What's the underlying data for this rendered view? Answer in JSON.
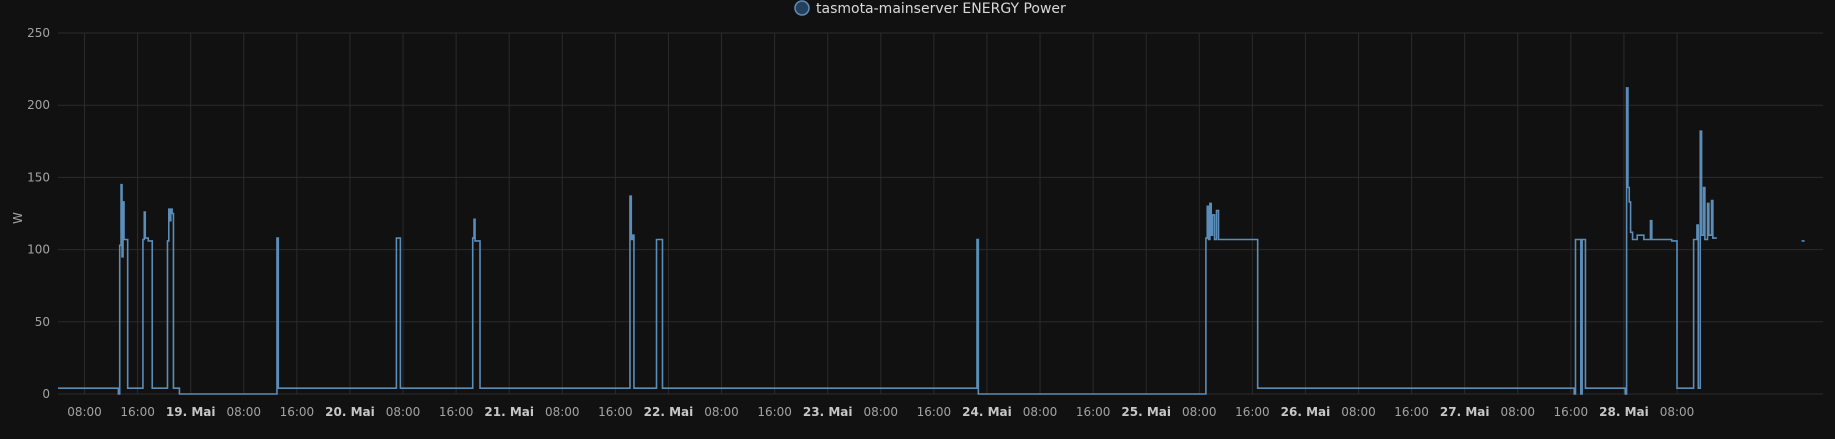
{
  "colors": {
    "background": "#111111",
    "grid": "#2b2b2b",
    "series": "#5b8db8",
    "legend_dot_fill": "#23405c",
    "legend_dot_stroke": "#5b8db8"
  },
  "chart_data": {
    "type": "line",
    "ylabel": "W",
    "ylim": [
      0,
      250
    ],
    "yticks": [
      0,
      50,
      100,
      150,
      200,
      250
    ],
    "xlim_hours": [
      0,
      266
    ],
    "x_ticks": [
      {
        "t": 4,
        "label": "08:00",
        "bold": false
      },
      {
        "t": 12,
        "label": "16:00",
        "bold": false
      },
      {
        "t": 20,
        "label": "19. Mai",
        "bold": true
      },
      {
        "t": 28,
        "label": "08:00",
        "bold": false
      },
      {
        "t": 36,
        "label": "16:00",
        "bold": false
      },
      {
        "t": 44,
        "label": "20. Mai",
        "bold": true
      },
      {
        "t": 52,
        "label": "08:00",
        "bold": false
      },
      {
        "t": 60,
        "label": "16:00",
        "bold": false
      },
      {
        "t": 68,
        "label": "21. Mai",
        "bold": true
      },
      {
        "t": 76,
        "label": "08:00",
        "bold": false
      },
      {
        "t": 84,
        "label": "16:00",
        "bold": false
      },
      {
        "t": 92,
        "label": "22. Mai",
        "bold": true
      },
      {
        "t": 100,
        "label": "08:00",
        "bold": false
      },
      {
        "t": 108,
        "label": "16:00",
        "bold": false
      },
      {
        "t": 116,
        "label": "23. Mai",
        "bold": true
      },
      {
        "t": 124,
        "label": "08:00",
        "bold": false
      },
      {
        "t": 132,
        "label": "16:00",
        "bold": false
      },
      {
        "t": 140,
        "label": "24. Mai",
        "bold": true
      },
      {
        "t": 148,
        "label": "08:00",
        "bold": false
      },
      {
        "t": 156,
        "label": "16:00",
        "bold": false
      },
      {
        "t": 164,
        "label": "25. Mai",
        "bold": true
      },
      {
        "t": 172,
        "label": "08:00",
        "bold": false
      },
      {
        "t": 180,
        "label": "16:00",
        "bold": false
      },
      {
        "t": 188,
        "label": "26. Mai",
        "bold": true
      },
      {
        "t": 196,
        "label": "08:00",
        "bold": false
      },
      {
        "t": 204,
        "label": "16:00",
        "bold": false
      },
      {
        "t": 212,
        "label": "27. Mai",
        "bold": true
      },
      {
        "t": 220,
        "label": "08:00",
        "bold": false
      },
      {
        "t": 228,
        "label": "16:00",
        "bold": false
      },
      {
        "t": 236,
        "label": "28. Mai",
        "bold": true
      },
      {
        "t": 244,
        "label": "08:00",
        "bold": false
      }
    ],
    "grid": true,
    "legend_position": "top-center",
    "series": [
      {
        "name": "tasmota-mainserver ENERGY Power",
        "step": true,
        "points": [
          [
            0,
            4
          ],
          [
            9.1,
            4
          ],
          [
            9.1,
            0
          ],
          [
            9.3,
            0
          ],
          [
            9.3,
            103
          ],
          [
            9.5,
            103
          ],
          [
            9.5,
            145
          ],
          [
            9.65,
            145
          ],
          [
            9.65,
            95
          ],
          [
            9.8,
            95
          ],
          [
            9.8,
            133
          ],
          [
            9.95,
            133
          ],
          [
            9.95,
            107
          ],
          [
            10.5,
            107
          ],
          [
            10.5,
            4
          ],
          [
            12.8,
            4
          ],
          [
            12.8,
            107
          ],
          [
            13.0,
            107
          ],
          [
            13.0,
            126
          ],
          [
            13.15,
            126
          ],
          [
            13.15,
            108
          ],
          [
            13.6,
            108
          ],
          [
            13.6,
            106
          ],
          [
            14.2,
            106
          ],
          [
            14.2,
            4
          ],
          [
            16.5,
            4
          ],
          [
            16.5,
            106
          ],
          [
            16.7,
            106
          ],
          [
            16.7,
            128
          ],
          [
            16.85,
            128
          ],
          [
            16.85,
            120
          ],
          [
            17.0,
            120
          ],
          [
            17.0,
            128
          ],
          [
            17.2,
            128
          ],
          [
            17.2,
            125
          ],
          [
            17.4,
            125
          ],
          [
            17.4,
            4
          ],
          [
            18.3,
            4
          ],
          [
            18.3,
            0
          ],
          [
            33,
            0
          ],
          [
            33,
            108
          ],
          [
            33.2,
            108
          ],
          [
            33.2,
            4
          ],
          [
            51,
            4
          ],
          [
            51,
            108
          ],
          [
            51.6,
            108
          ],
          [
            51.6,
            4
          ],
          [
            62.5,
            4
          ],
          [
            62.5,
            108
          ],
          [
            62.7,
            108
          ],
          [
            62.7,
            121
          ],
          [
            62.85,
            121
          ],
          [
            62.85,
            106
          ],
          [
            63.6,
            106
          ],
          [
            63.6,
            4
          ],
          [
            86.2,
            4
          ],
          [
            86.2,
            137
          ],
          [
            86.4,
            137
          ],
          [
            86.4,
            107
          ],
          [
            86.6,
            107
          ],
          [
            86.6,
            110
          ],
          [
            86.8,
            110
          ],
          [
            86.8,
            4
          ],
          [
            90.2,
            4
          ],
          [
            90.2,
            107
          ],
          [
            91.1,
            107
          ],
          [
            91.1,
            4
          ],
          [
            138.5,
            4
          ],
          [
            138.5,
            107
          ],
          [
            138.7,
            107
          ],
          [
            138.7,
            0
          ],
          [
            173,
            0
          ],
          [
            173,
            108
          ],
          [
            173.2,
            108
          ],
          [
            173.2,
            130
          ],
          [
            173.4,
            130
          ],
          [
            173.4,
            107
          ],
          [
            173.6,
            107
          ],
          [
            173.6,
            132
          ],
          [
            173.8,
            132
          ],
          [
            173.8,
            110
          ],
          [
            174.0,
            110
          ],
          [
            174.0,
            124
          ],
          [
            174.3,
            124
          ],
          [
            174.3,
            107
          ],
          [
            174.6,
            107
          ],
          [
            174.6,
            127
          ],
          [
            174.9,
            127
          ],
          [
            174.9,
            107
          ],
          [
            180.8,
            107
          ],
          [
            180.8,
            4
          ],
          [
            228.5,
            4
          ],
          [
            228.5,
            0
          ],
          [
            228.7,
            0
          ],
          [
            228.7,
            107
          ],
          [
            229.5,
            107
          ],
          [
            229.5,
            0
          ],
          [
            229.7,
            0
          ],
          [
            229.7,
            107
          ],
          [
            230.2,
            107
          ],
          [
            230.2,
            4
          ],
          [
            236.2,
            4
          ],
          [
            236.2,
            0
          ],
          [
            236.4,
            0
          ],
          [
            236.4,
            212
          ],
          [
            236.6,
            212
          ],
          [
            236.6,
            143
          ],
          [
            236.8,
            143
          ],
          [
            236.8,
            133
          ],
          [
            237.0,
            133
          ],
          [
            237.0,
            112
          ],
          [
            237.3,
            112
          ],
          [
            237.3,
            107
          ],
          [
            238.0,
            107
          ],
          [
            238.0,
            110
          ],
          [
            239.0,
            110
          ],
          [
            239.0,
            107
          ],
          [
            240.0,
            107
          ],
          [
            240.0,
            120
          ],
          [
            240.2,
            120
          ],
          [
            240.2,
            107
          ],
          [
            243.2,
            107
          ],
          [
            243.2,
            106
          ],
          [
            244.0,
            106
          ],
          [
            244.0,
            4
          ],
          [
            246.5,
            4
          ],
          [
            246.5,
            107
          ],
          [
            247.0,
            107
          ],
          [
            247.0,
            117
          ],
          [
            247.2,
            117
          ],
          [
            247.2,
            4
          ],
          [
            247.5,
            4
          ],
          [
            247.5,
            182
          ],
          [
            247.7,
            182
          ],
          [
            247.7,
            110
          ],
          [
            248.0,
            110
          ],
          [
            248.0,
            143
          ],
          [
            248.2,
            143
          ],
          [
            248.2,
            107
          ],
          [
            248.6,
            107
          ],
          [
            248.6,
            132
          ],
          [
            248.8,
            132
          ],
          [
            248.8,
            110
          ],
          [
            249.2,
            110
          ],
          [
            249.2,
            134
          ],
          [
            249.4,
            134
          ],
          [
            249.4,
            108
          ],
          [
            250.0,
            108
          ]
        ],
        "extra_points": [
          [
            263,
            106
          ]
        ]
      }
    ]
  }
}
